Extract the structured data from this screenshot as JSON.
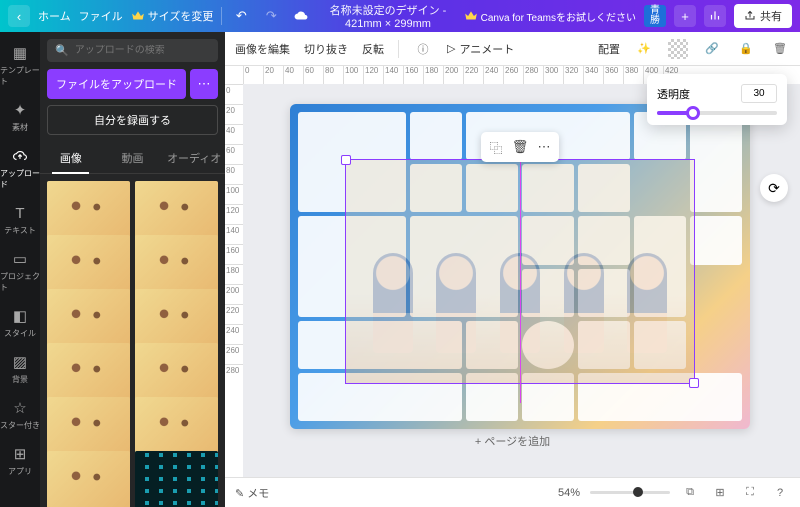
{
  "topbar": {
    "home": "ホーム",
    "file": "ファイル",
    "resize": "サイズを変更",
    "title": "名称未設定のデザイン - 421mm × 299mm",
    "teams": "Canva for Teamsをお試しください",
    "avatar": "青\n勝",
    "share": "共有"
  },
  "rail": {
    "template": "テンプレート",
    "elements": "素材",
    "upload": "アップロード",
    "text": "テキスト",
    "project": "プロジェクト",
    "style": "スタイル",
    "background": "背景",
    "starred": "スター付き",
    "apps": "アプリ"
  },
  "panel": {
    "search": "アップロードの検索",
    "upload": "ファイルをアップロード",
    "record": "自分を録画する",
    "tabs": {
      "image": "画像",
      "video": "動画",
      "audio": "オーディオ"
    }
  },
  "ctool": {
    "edit": "画像を編集",
    "crop": "切り抜き",
    "flip": "反転",
    "animate": "アニメート",
    "position": "配置"
  },
  "opacity": {
    "label": "透明度",
    "value": "30"
  },
  "canvas": {
    "addpage": "+ ページを追加"
  },
  "footer": {
    "memo": "メモ",
    "zoom": "54%"
  },
  "rulerH": [
    "0",
    "20",
    "40",
    "60",
    "80",
    "100",
    "120",
    "140",
    "160",
    "180",
    "200",
    "220",
    "240",
    "260",
    "280",
    "300",
    "320",
    "340",
    "360",
    "380",
    "400",
    "420"
  ],
  "rulerV": [
    "0",
    "20",
    "40",
    "60",
    "80",
    "100",
    "120",
    "140",
    "160",
    "180",
    "200",
    "220",
    "240",
    "260",
    "280"
  ]
}
